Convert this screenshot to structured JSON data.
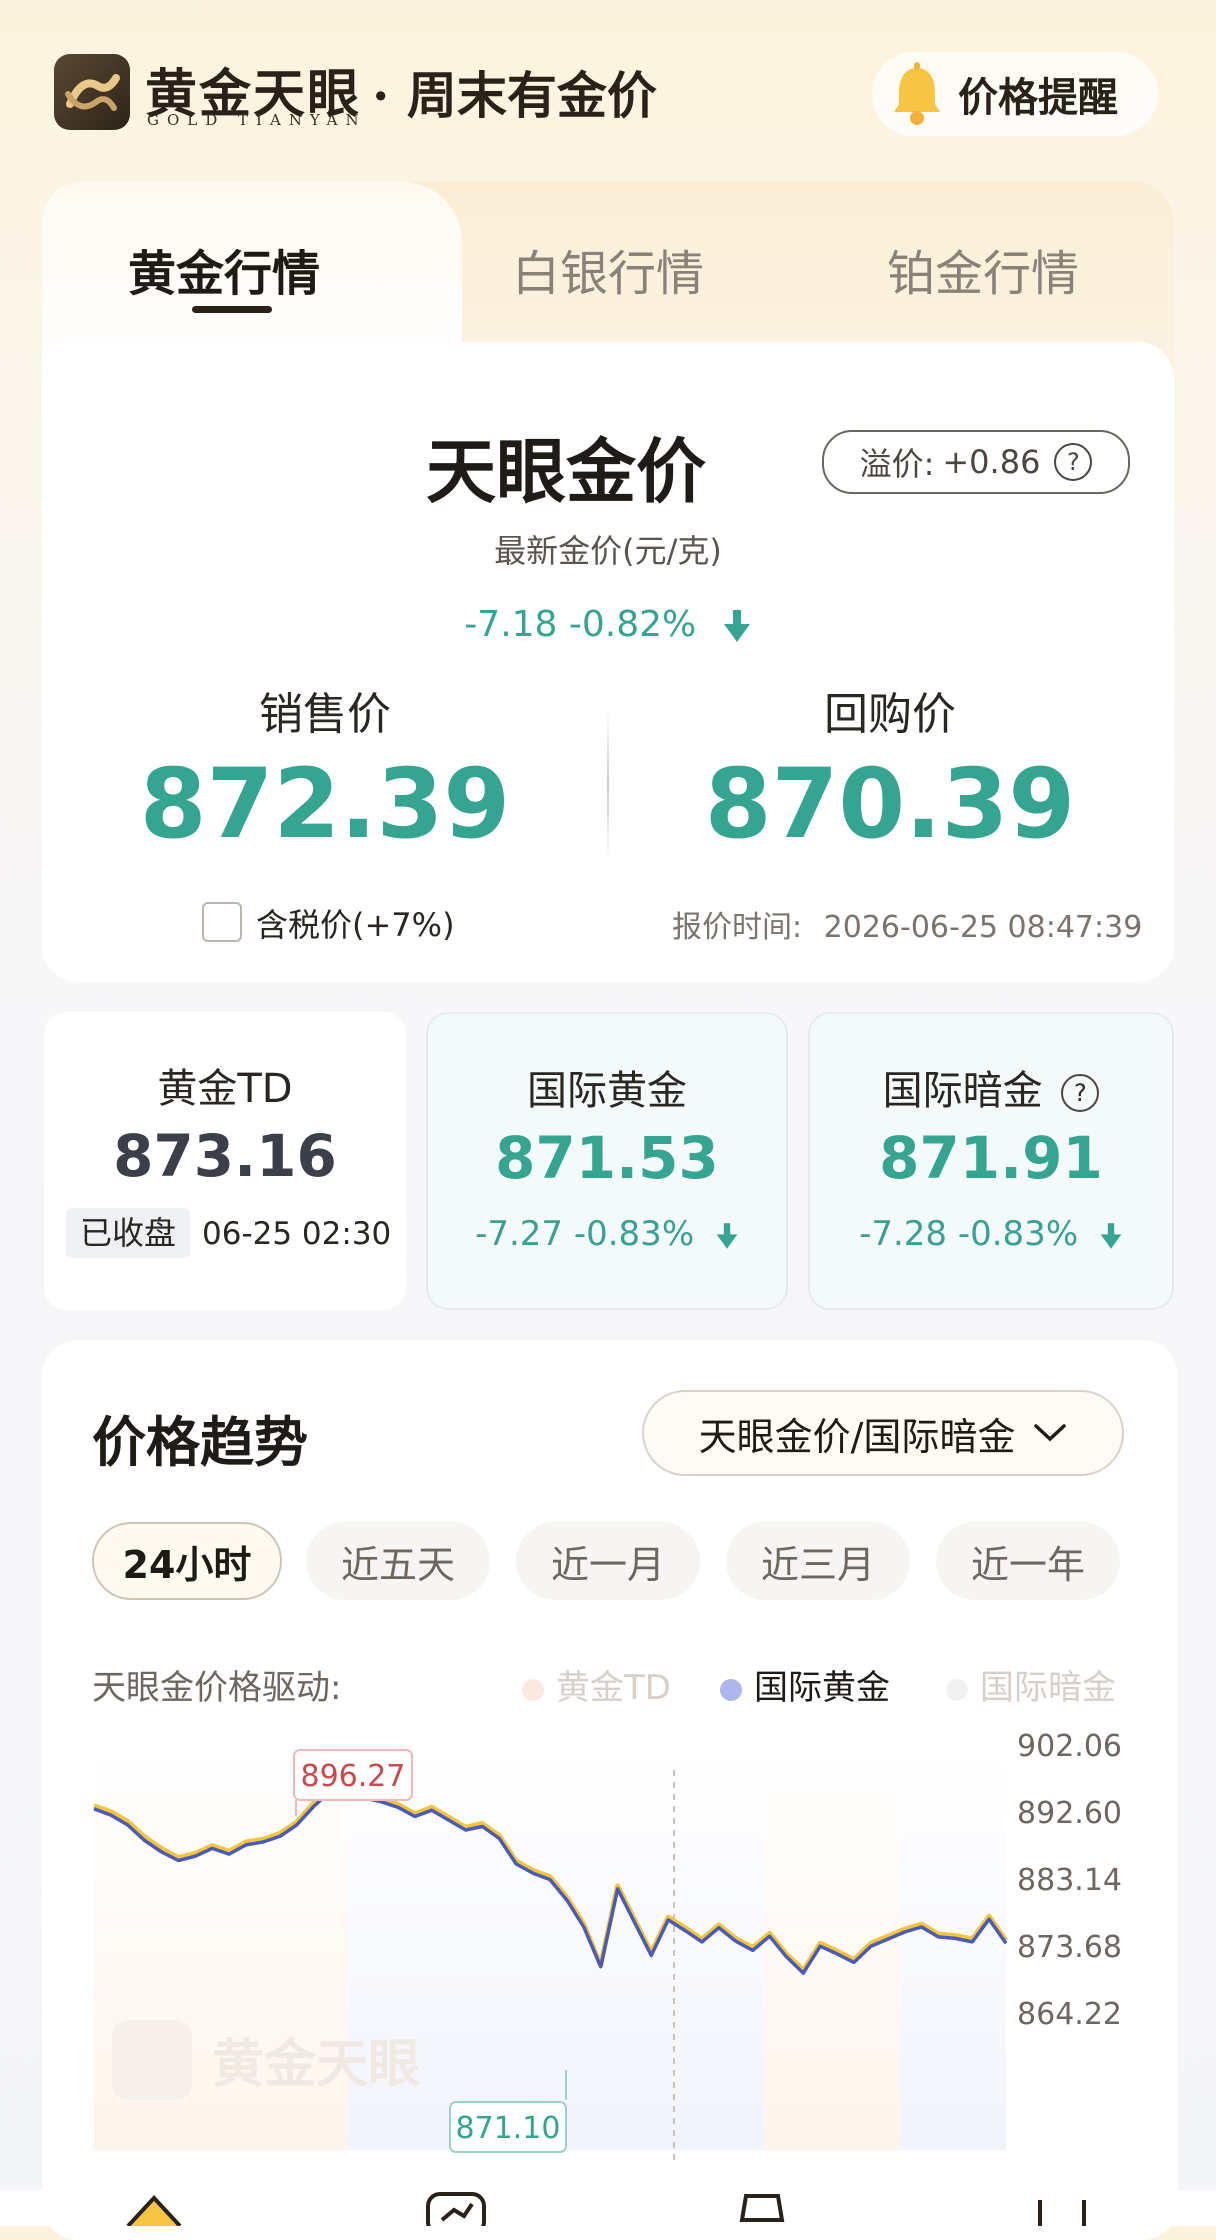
{
  "header": {
    "brand_name": "黄金天眼",
    "brand_sub": "GOLD TIANYAN",
    "slogan": "· 周末有金价",
    "alert_label": "价格提醒"
  },
  "tabs": [
    {
      "label": "黄金行情",
      "active": true
    },
    {
      "label": "白银行情",
      "active": false
    },
    {
      "label": "铂金行情",
      "active": false
    }
  ],
  "price_card": {
    "title": "天眼金价",
    "subtitle": "最新金价(元/克)",
    "premium_label": "溢价:",
    "premium_value": "+0.86",
    "help_glyph": "?",
    "change": "-7.18 -0.82%",
    "sell_label": "销售价",
    "sell_value": "872.39",
    "buy_label": "回购价",
    "buy_value": "870.39",
    "tax_label": "含税价(+7%)",
    "tax_checked": false,
    "quote_time_label": "报价时间:",
    "quote_time": "2026-06-25 08:47:39"
  },
  "mini_cards": [
    {
      "label": "黄金TD",
      "value": "873.16",
      "status": "已收盘",
      "time": "06-25 02:30"
    },
    {
      "label": "国际黄金",
      "value": "871.53",
      "change": "-7.27 -0.83%"
    },
    {
      "label": "国际暗金",
      "value": "871.91",
      "change": "-7.28 -0.83%",
      "help_glyph": "?"
    }
  ],
  "trend": {
    "title": "价格趋势",
    "selector_label": "天眼金价/国际暗金",
    "ranges": [
      {
        "label": "24小时",
        "active": true
      },
      {
        "label": "近五天",
        "active": false
      },
      {
        "label": "近一月",
        "active": false
      },
      {
        "label": "近三月",
        "active": false
      },
      {
        "label": "近一年",
        "active": false
      }
    ],
    "drive_label": "天眼金价格驱动:",
    "legend": [
      {
        "label": "黄金TD",
        "active": false
      },
      {
        "label": "国际黄金",
        "active": true
      },
      {
        "label": "国际暗金",
        "active": false
      }
    ],
    "watermark": "黄金天眼"
  },
  "colors": {
    "accent_green": "#35a592",
    "dark_text": "#1f1b17",
    "gold_line": "#f2c53b",
    "blue_line": "#4a5ab8",
    "high_label": "#c94a4a"
  },
  "chart_data": {
    "type": "line",
    "ylim": [
      864.22,
      902.06
    ],
    "y_ticks": [
      "902.06",
      "892.60",
      "883.14",
      "873.68",
      "864.22"
    ],
    "max_annotation": "896.27",
    "min_annotation": "871.10",
    "series": [
      {
        "values": [
          893.6,
          892.8,
          891.4,
          889.2,
          887.6,
          886.3,
          886.9,
          888.0,
          887.2,
          888.5,
          888.9,
          889.7,
          891.3,
          894.0,
          896.2,
          895.8,
          895.1,
          894.6,
          893.8,
          892.5,
          893.4,
          892.0,
          890.6,
          891.1,
          889.4,
          885.8,
          884.5,
          883.6,
          880.7,
          876.9,
          871.1,
          882.3,
          877.6,
          872.9,
          877.9,
          876.4,
          874.8,
          876.8,
          874.9,
          873.6,
          875.6,
          872.7,
          870.4,
          874.2,
          873.1,
          871.9,
          874.2,
          875.2,
          876.2,
          876.9,
          875.5,
          875.3,
          874.8,
          878.0,
          874.6
        ]
      },
      {
        "values": [
          893.2,
          892.3,
          890.9,
          888.7,
          887.1,
          885.9,
          886.5,
          887.6,
          886.8,
          888.1,
          888.5,
          889.3,
          890.9,
          893.5,
          895.7,
          895.4,
          894.7,
          894.2,
          893.4,
          892.1,
          893.0,
          891.6,
          890.2,
          890.7,
          889.0,
          885.4,
          884.1,
          883.2,
          880.3,
          876.5,
          870.9,
          881.9,
          877.2,
          872.5,
          877.5,
          876.0,
          874.4,
          876.4,
          874.5,
          873.2,
          875.2,
          872.3,
          870.0,
          873.8,
          872.7,
          871.5,
          873.8,
          874.8,
          875.8,
          876.5,
          875.1,
          874.9,
          874.4,
          877.6,
          874.2
        ]
      }
    ]
  }
}
